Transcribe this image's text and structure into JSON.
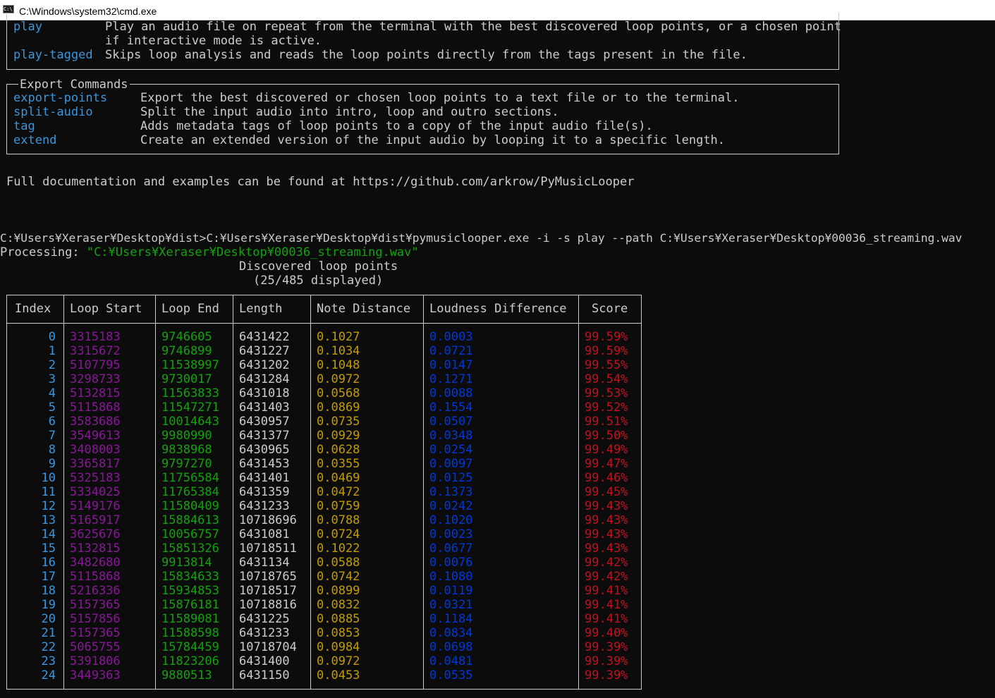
{
  "window": {
    "title": "C:\\Windows\\system32\\cmd.exe",
    "icon": "console-icon"
  },
  "top_panel": {
    "rows": [
      {
        "name": "play",
        "desc": "Play an audio file on repeat from the terminal with the best discovered loop points, or a chosen point"
      },
      {
        "name": "",
        "desc": "if interactive mode is active."
      },
      {
        "name": "play-tagged",
        "desc": "Skips loop analysis and reads the loop points directly from the tags present in the file."
      }
    ]
  },
  "export_panel": {
    "title": "Export Commands",
    "rows": [
      {
        "name": "export-points",
        "desc": "Export the best discovered or chosen loop points to a text file or to the terminal."
      },
      {
        "name": "split-audio",
        "desc": "Split the input audio into intro, loop and outro sections."
      },
      {
        "name": "tag",
        "desc": "Adds metadata tags of loop points to a copy of the input audio file(s)."
      },
      {
        "name": "extend",
        "desc": "Create an extended version of the input audio by looping it to a specific length."
      }
    ]
  },
  "doc_line": "Full documentation and examples can be found at https://github.com/arkrow/PyMusicLooper",
  "prompt_line": "C:¥Users¥Xeraser¥Desktop¥dist>C:¥Users¥Xeraser¥Desktop¥dist¥pymusiclooper.exe -i -s play --path C:¥Users¥Xeraser¥Desktop¥00036_streaming.wav",
  "processing": {
    "label": "Processing: ",
    "path": "\"C:¥Users¥Xeraser¥Desktop¥00036_streaming.wav\""
  },
  "table": {
    "title": "Discovered loop points",
    "subtitle": "(25/485 displayed)",
    "headers": [
      "Index",
      "Loop Start",
      "Loop End",
      "Length",
      "Note Distance",
      "Loudness Difference",
      "Score"
    ],
    "rows": [
      [
        "0",
        "3315183",
        "9746605",
        "6431422",
        "0.1027",
        "0.0003",
        "99.59%"
      ],
      [
        "1",
        "3315672",
        "9746899",
        "6431227",
        "0.1034",
        "0.0721",
        "99.59%"
      ],
      [
        "2",
        "5107795",
        "11538997",
        "6431202",
        "0.1048",
        "0.0147",
        "99.55%"
      ],
      [
        "3",
        "3298733",
        "9730017",
        "6431284",
        "0.0972",
        "0.1271",
        "99.54%"
      ],
      [
        "4",
        "5132815",
        "11563833",
        "6431018",
        "0.0568",
        "0.0088",
        "99.53%"
      ],
      [
        "5",
        "5115868",
        "11547271",
        "6431403",
        "0.0869",
        "0.1554",
        "99.52%"
      ],
      [
        "6",
        "3583686",
        "10014643",
        "6430957",
        "0.0735",
        "0.0507",
        "99.51%"
      ],
      [
        "7",
        "3549613",
        "9980990",
        "6431377",
        "0.0929",
        "0.0348",
        "99.50%"
      ],
      [
        "8",
        "3408003",
        "9838968",
        "6430965",
        "0.0628",
        "0.0254",
        "99.49%"
      ],
      [
        "9",
        "3365817",
        "9797270",
        "6431453",
        "0.0355",
        "0.0097",
        "99.47%"
      ],
      [
        "10",
        "5325183",
        "11756584",
        "6431401",
        "0.0469",
        "0.0125",
        "99.46%"
      ],
      [
        "11",
        "5334025",
        "11765384",
        "6431359",
        "0.0472",
        "0.1373",
        "99.45%"
      ],
      [
        "12",
        "5149176",
        "11580409",
        "6431233",
        "0.0759",
        "0.0242",
        "99.43%"
      ],
      [
        "13",
        "5165917",
        "15884613",
        "10718696",
        "0.0788",
        "0.1020",
        "99.43%"
      ],
      [
        "14",
        "3625676",
        "10056757",
        "6431081",
        "0.0724",
        "0.0023",
        "99.43%"
      ],
      [
        "15",
        "5132815",
        "15851326",
        "10718511",
        "0.1022",
        "0.0677",
        "99.43%"
      ],
      [
        "16",
        "3482680",
        "9913814",
        "6431134",
        "0.0588",
        "0.0076",
        "99.42%"
      ],
      [
        "17",
        "5115868",
        "15834633",
        "10718765",
        "0.0742",
        "0.1080",
        "99.42%"
      ],
      [
        "18",
        "5216336",
        "15934853",
        "10718517",
        "0.0899",
        "0.0119",
        "99.41%"
      ],
      [
        "19",
        "5157365",
        "15876181",
        "10718816",
        "0.0832",
        "0.0321",
        "99.41%"
      ],
      [
        "20",
        "5157856",
        "11589081",
        "6431225",
        "0.0885",
        "0.1184",
        "99.41%"
      ],
      [
        "21",
        "5157365",
        "11588598",
        "6431233",
        "0.0853",
        "0.0834",
        "99.40%"
      ],
      [
        "22",
        "5065755",
        "15784459",
        "10718704",
        "0.0984",
        "0.0698",
        "99.39%"
      ],
      [
        "23",
        "5391806",
        "11823206",
        "6431400",
        "0.0972",
        "0.0481",
        "99.39%"
      ],
      [
        "24",
        "3449363",
        "9880513",
        "6431150",
        "0.0453",
        "0.0535",
        "99.39%"
      ]
    ]
  },
  "colors": {
    "background": "#0c0c0c",
    "foreground": "#cccccc",
    "index": "#3a96dd",
    "loop_start": "#881798",
    "loop_end": "#13a10e",
    "note_distance": "#c19c00",
    "loudness": "#0037da",
    "score": "#c50f1f"
  }
}
